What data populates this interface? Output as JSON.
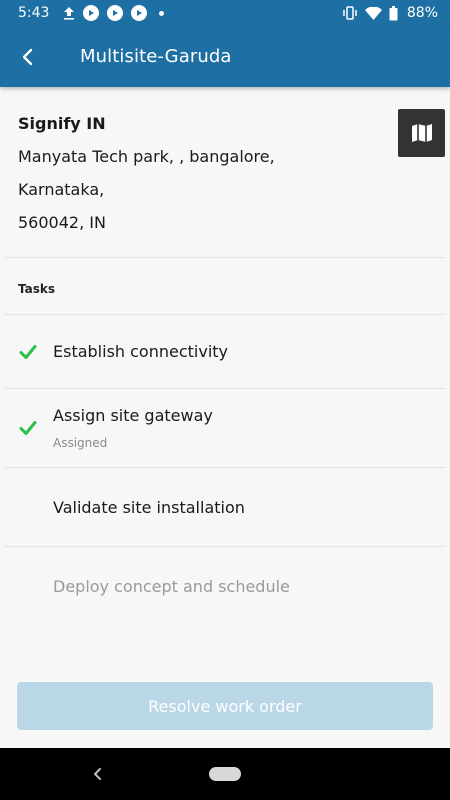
{
  "status_bar": {
    "time": "5:43",
    "battery": "88%",
    "icons": [
      "upload-icon",
      "play-icon",
      "play-icon",
      "play-icon",
      "dot-icon",
      "vibrate-icon",
      "wifi-icon",
      "battery-icon"
    ]
  },
  "app_bar": {
    "title": "Multisite-Garuda",
    "back_icon": "chevron-left-icon"
  },
  "site": {
    "name": "Signify IN",
    "address_lines": [
      "Manyata Tech park, , bangalore,",
      "Karnataka,",
      "560042, IN"
    ],
    "map_icon": "map-icon"
  },
  "tasks": {
    "heading": "Tasks",
    "items": [
      {
        "label": "Establish connectivity",
        "status": "done",
        "sub": ""
      },
      {
        "label": "Assign site gateway",
        "status": "done",
        "sub": "Assigned"
      },
      {
        "label": "Validate site installation",
        "status": "pending",
        "sub": ""
      },
      {
        "label": "Deploy concept and schedule",
        "status": "disabled",
        "sub": ""
      }
    ]
  },
  "actions": {
    "resolve_label": "Resolve work order"
  },
  "colors": {
    "primary": "#1e6fa3",
    "check": "#2bbf4a",
    "button_disabled": "#b9d7e6"
  }
}
